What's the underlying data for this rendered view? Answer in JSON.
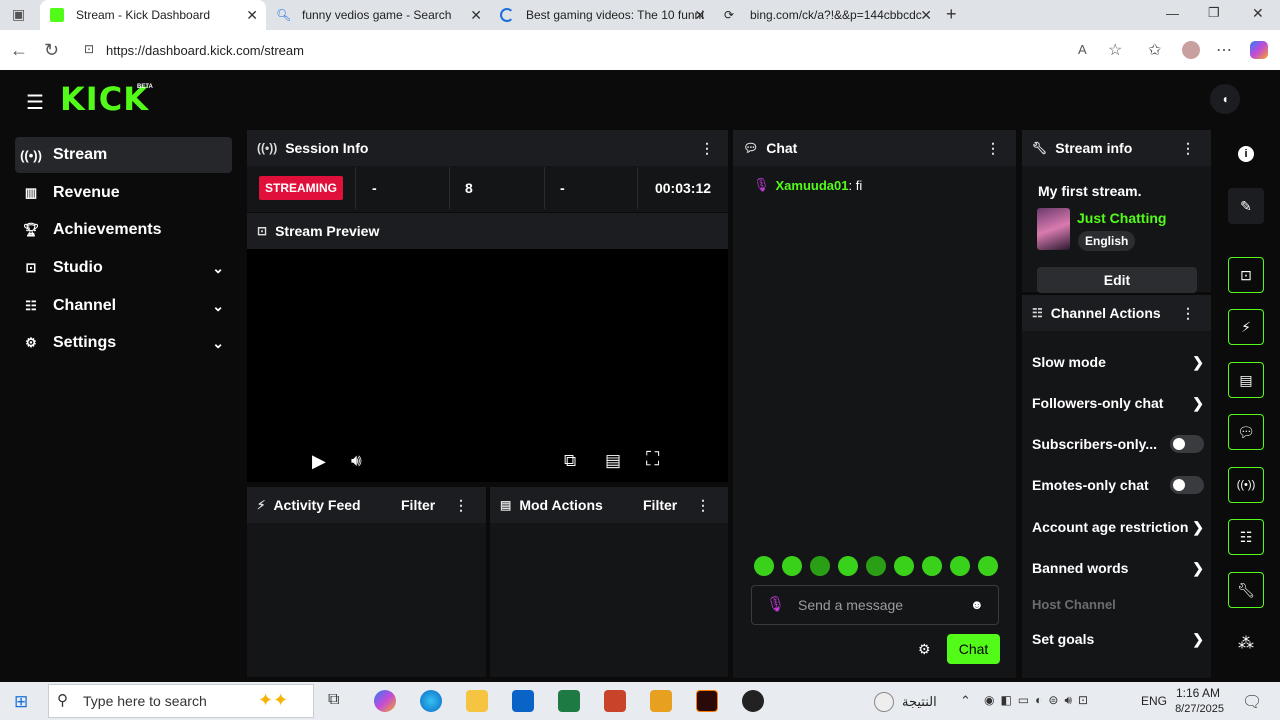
{
  "browser": {
    "tabs": [
      {
        "title": "Stream - Kick Dashboard"
      },
      {
        "title": "funny vedios game - Search"
      },
      {
        "title": "Best gaming videos: The 10 funni"
      },
      {
        "title": "bing.com/ck/a?!&&p=144cbbcdc"
      }
    ],
    "url": "https://dashboard.kick.com/stream"
  },
  "app": {
    "logo": "KICK",
    "logo_badge": "BETA",
    "colors": {
      "accent": "#53fc18",
      "live": "#e0103b"
    }
  },
  "sidebar": {
    "items": [
      {
        "label": "Stream",
        "icon": "stream-icon"
      },
      {
        "label": "Revenue",
        "icon": "revenue-icon"
      },
      {
        "label": "Achievements",
        "icon": "trophy-icon"
      },
      {
        "label": "Studio",
        "icon": "studio-icon"
      },
      {
        "label": "Channel",
        "icon": "channel-icon"
      },
      {
        "label": "Settings",
        "icon": "gear-icon"
      }
    ]
  },
  "session": {
    "title": "Session Info",
    "status": "STREAMING",
    "stats": [
      "-",
      "8",
      "-",
      "00:03:12"
    ]
  },
  "preview": {
    "title": "Stream Preview"
  },
  "activity": {
    "title": "Activity Feed",
    "filter": "Filter"
  },
  "mod": {
    "title": "Mod Actions",
    "filter": "Filter"
  },
  "chat": {
    "title": "Chat",
    "messages": [
      {
        "user": "Xamuuda01",
        "text": ": fi"
      }
    ],
    "placeholder": "Send a message",
    "send_label": "Chat"
  },
  "stream_info": {
    "title": "Stream info",
    "stream_title": "My first stream.",
    "category": "Just Chatting",
    "language": "English",
    "edit_label": "Edit"
  },
  "channel_actions": {
    "title": "Channel Actions",
    "items": [
      {
        "label": "Slow mode",
        "control": "arrow"
      },
      {
        "label": "Followers-only chat",
        "control": "arrow"
      },
      {
        "label": "Subscribers-only...",
        "control": "toggle"
      },
      {
        "label": "Emotes-only chat",
        "control": "toggle"
      },
      {
        "label": "Account age restriction",
        "control": "arrow"
      },
      {
        "label": "Banned words",
        "control": "arrow"
      },
      {
        "label": "Host Channel",
        "control": "none"
      },
      {
        "label": "Set goals",
        "control": "arrow"
      }
    ]
  },
  "taskbar": {
    "search_placeholder": "Type here to search",
    "weather_label": "النتيجة",
    "lang": "ENG",
    "time": "1:16 AM",
    "date": "8/27/2025"
  }
}
